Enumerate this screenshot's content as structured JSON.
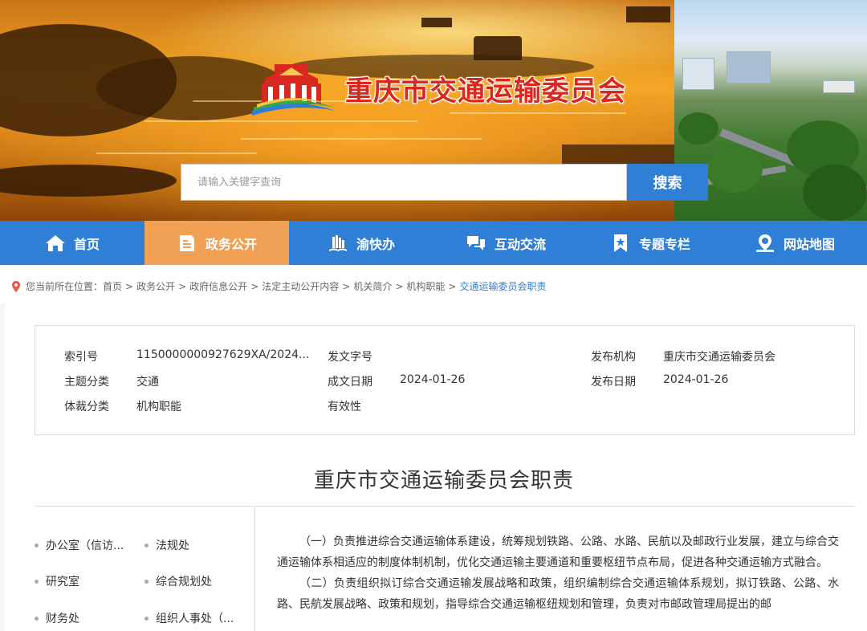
{
  "header": {
    "site_title": "重庆市交通运输委员会",
    "search_placeholder": "请输入关键字查询",
    "search_button": "搜索",
    "colors": {
      "accent_blue": "#2f7fd6",
      "active_orange": "#f0a155",
      "title_red": "#d8281f"
    }
  },
  "nav": {
    "items": [
      {
        "label": "首页",
        "icon": "home-icon"
      },
      {
        "label": "政务公开",
        "icon": "document-icon",
        "active": true
      },
      {
        "label": "渝快办",
        "icon": "book-icon"
      },
      {
        "label": "互动交流",
        "icon": "chat-icon"
      },
      {
        "label": "专题专栏",
        "icon": "bookmark-star-icon"
      },
      {
        "label": "网站地图",
        "icon": "map-pin-icon"
      }
    ]
  },
  "breadcrumb": {
    "prefix": "您当前所在位置：",
    "items": [
      "首页",
      "政务公开",
      "政府信息公开",
      "法定主动公开内容",
      "机关简介",
      "机构职能"
    ],
    "current": "交通运输委员会职责"
  },
  "meta": {
    "index_label": "索引号",
    "index_value": "1150000000927629XA/2024...",
    "doc_no_label": "发文字号",
    "doc_no_value": "",
    "publisher_label": "发布机构",
    "publisher_value": "重庆市交通运输委员会",
    "topic_label": "主题分类",
    "topic_value": "交通",
    "created_label": "成文日期",
    "created_value": "2024-01-26",
    "published_label": "发布日期",
    "published_value": "2024-01-26",
    "genre_label": "体裁分类",
    "genre_value": "机构职能",
    "validity_label": "有效性",
    "validity_value": ""
  },
  "doc": {
    "title": "重庆市交通运输委员会职责",
    "paragraphs": [
      "（一）负责推进综合交通运输体系建设，统筹规划铁路、公路、水路、民航以及邮政行业发展，建立与综合交通运输体系相适应的制度体制机制，优化交通运输主要通道和重要枢纽节点布局，促进各种交通运输方式融合。",
      "（二）负责组织拟订综合交通运输发展战略和政策，组织编制综合交通运输体系规划，拟订铁路、公路、水路、民航发展战略、政策和规划，指导综合交通运输枢纽规划和管理，负责对市邮政管理局提出的邮"
    ]
  },
  "sidebar": {
    "items": [
      "办公室（信访...",
      "法规处",
      "研究室",
      "综合规划处",
      "财务处",
      "组织人事处（..."
    ]
  }
}
